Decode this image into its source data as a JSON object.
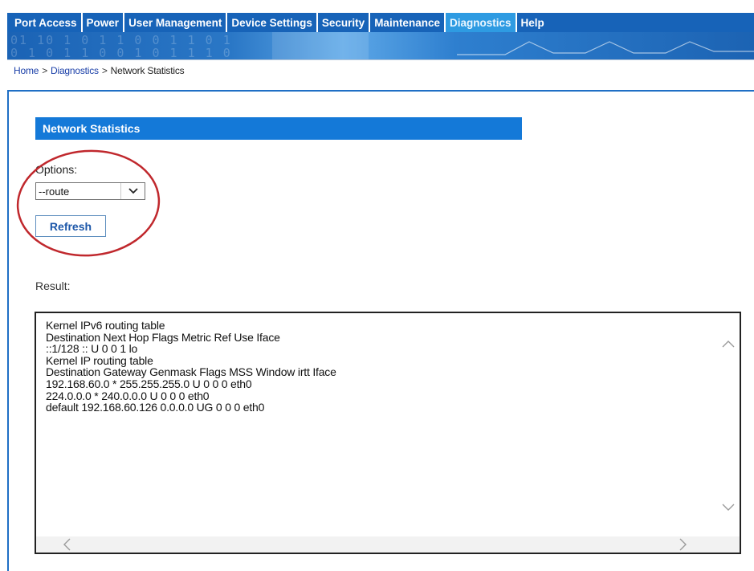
{
  "nav": {
    "tabs": [
      {
        "label": "Port Access"
      },
      {
        "label": "Power"
      },
      {
        "label": "User Management"
      },
      {
        "label": "Device Settings"
      },
      {
        "label": "Security"
      },
      {
        "label": "Maintenance"
      },
      {
        "label": "Diagnostics"
      },
      {
        "label": "Help"
      }
    ],
    "active": "Diagnostics"
  },
  "breadcrumb": {
    "home": "Home",
    "section": "Diagnostics",
    "current": "Network Statistics",
    "separator": ">"
  },
  "page": {
    "section_title": "Network Statistics",
    "options_label": "Options:",
    "selected_option": "--route",
    "refresh_label": "Refresh",
    "result_label": "Result:"
  },
  "result": {
    "lines": [
      "Kernel IPv6 routing table",
      "Destination Next Hop Flags Metric Ref Use Iface",
      "::1/128 :: U 0 0 1 lo",
      "Kernel IP routing table",
      "Destination Gateway Genmask Flags MSS Window irtt Iface",
      "192.168.60.0 * 255.255.255.0 U 0 0 0 eth0",
      "224.0.0.0 * 240.0.0.0 U 0 0 0 eth0",
      "default 192.168.60.126 0.0.0.0 UG 0 0 0 eth0"
    ]
  },
  "colors": {
    "nav_bg": "#1763b8",
    "nav_active": "#2e9be2",
    "section_header": "#1479d8",
    "highlight_ring": "#c0282d"
  }
}
